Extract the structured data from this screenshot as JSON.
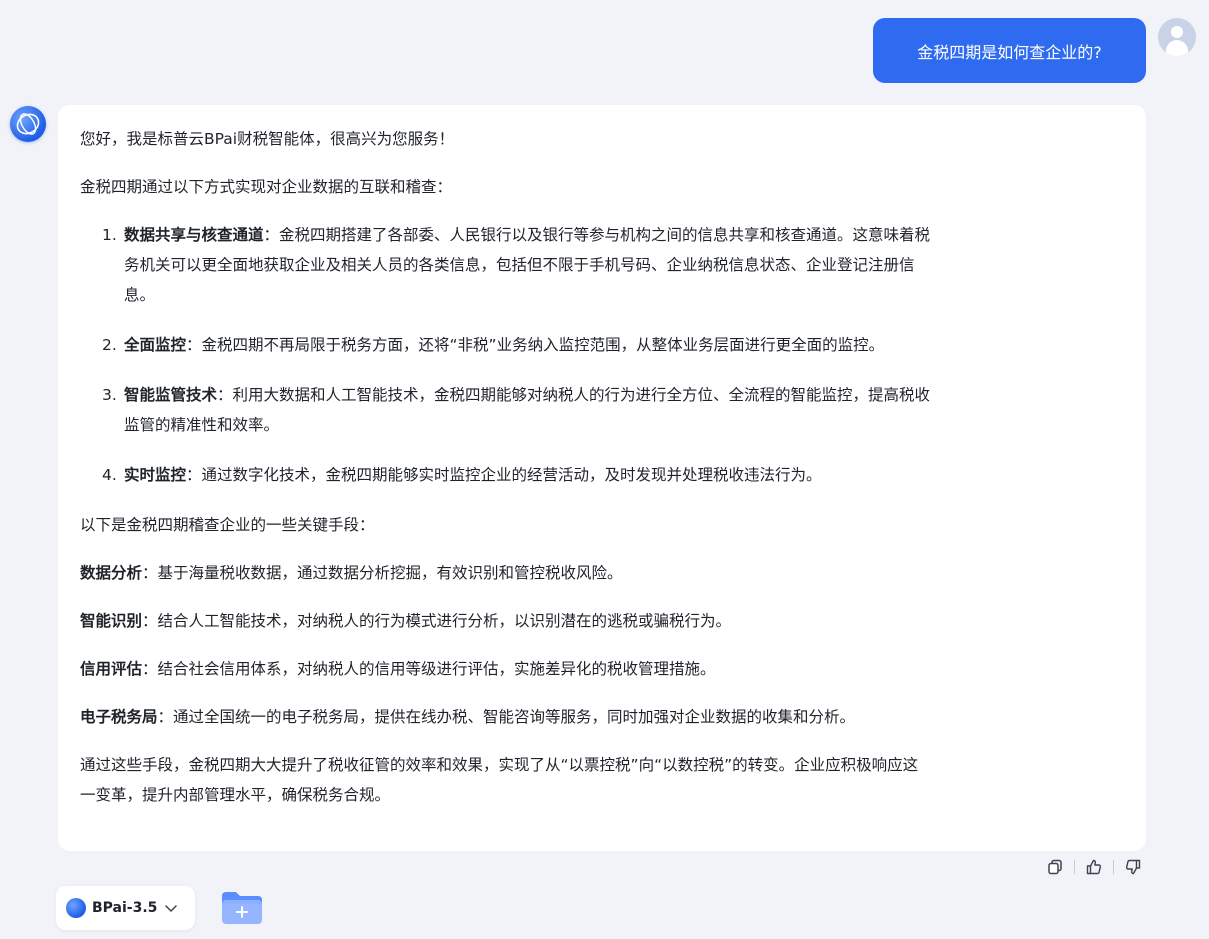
{
  "user_message": "金税四期是如何查企业的?",
  "answer": {
    "greeting": "您好，我是标普云BPai财税智能体，很高兴为您服务！",
    "intro": "金税四期通过以下方式实现对企业数据的互联和稽查：",
    "list": [
      {
        "num": "1.",
        "title": "数据共享与核查通道",
        "line1": "：金税四期搭建了各部委、人民银行以及银行等参与机构之间的信息共享和核查通道。这意味着税",
        "line2": "务机关可以更全面地获取企业及相关人员的各类信息，包括但不限于手机号码、企业纳税信息状态、企业登记注册信",
        "line3": "息。"
      },
      {
        "num": "2.",
        "title": "全面监控",
        "line1": "：金税四期不再局限于税务方面，还将“非税”业务纳入监控范围，从整体业务层面进行更全面的监控。"
      },
      {
        "num": "3.",
        "title": "智能监管技术",
        "line1": "：利用大数据和人工智能技术，金税四期能够对纳税人的行为进行全方位、全流程的智能监控，提高税收",
        "line2": "监管的精准性和效率。"
      },
      {
        "num": "4.",
        "title": "实时监控",
        "line1": "：通过数字化技术，金税四期能够实时监控企业的经营活动，及时发现并处理税收违法行为。"
      }
    ],
    "means_intro": "以下是金税四期稽查企业的一些关键手段：",
    "means": [
      {
        "title": "数据分析",
        "text": "：基于海量税收数据，通过数据分析挖掘，有效识别和管控税收风险。"
      },
      {
        "title": "智能识别",
        "text": "：结合人工智能技术，对纳税人的行为模式进行分析，以识别潜在的逃税或骗税行为。"
      },
      {
        "title": "信用评估",
        "text": "：结合社会信用体系，对纳税人的信用等级进行评估，实施差异化的税收管理措施。"
      },
      {
        "title": "电子税务局",
        "text": "：通过全国统一的电子税务局，提供在线办税、智能咨询等服务，同时加强对企业数据的收集和分析。"
      }
    ],
    "conclusion_line1": "通过这些手段，金税四期大大提升了税收征管的效率和效果，实现了从“以票控税”向“以数控税”的转变。企业应积极响应这",
    "conclusion_line2": "一变革，提升内部管理水平，确保税务合规。"
  },
  "actions": {
    "copy_icon": "copy-icon",
    "like_icon": "thumbs-up-icon",
    "dislike_icon": "thumbs-down-icon"
  },
  "model_selector": {
    "label": "BPai-3.5",
    "icon": "chevron-down-icon"
  },
  "colors": {
    "accent": "#2f6bf0",
    "background": "#f1f3f8",
    "card": "#ffffff"
  }
}
